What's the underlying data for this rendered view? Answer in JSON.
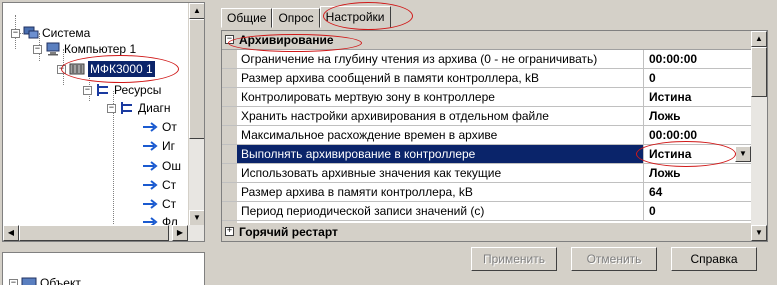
{
  "tree": {
    "items": [
      {
        "label": "Система",
        "expander": "−",
        "icon": "system-icon"
      },
      {
        "label": "Компьютер 1",
        "expander": "−",
        "icon": "computer-icon"
      },
      {
        "label": "МФК3000 1",
        "expander": "−",
        "icon": "controller-icon",
        "selected": true
      },
      {
        "label": "Ресурсы",
        "expander": "−",
        "icon": "resources-icon"
      },
      {
        "label": "Диагн",
        "expander": "−",
        "icon": "diagnostics-icon"
      },
      {
        "label": "От",
        "icon": "arrow-icon"
      },
      {
        "label": "Иг",
        "icon": "arrow-icon"
      },
      {
        "label": "Ош",
        "icon": "arrow-icon"
      },
      {
        "label": "Ст",
        "icon": "arrow-icon"
      },
      {
        "label": "Ст",
        "icon": "arrow-icon"
      },
      {
        "label": "Фл",
        "icon": "arrow-icon"
      }
    ]
  },
  "bottom_tree": {
    "item_label": "Объект"
  },
  "tabs": [
    {
      "label": "Общие",
      "active": false
    },
    {
      "label": "Опрос",
      "active": false
    },
    {
      "label": "Настройки",
      "active": true
    }
  ],
  "grid": {
    "categories": [
      {
        "label": "Архивирование",
        "expander": "−"
      },
      {
        "label": "Горячий рестарт",
        "expander": "+"
      }
    ],
    "rows": [
      {
        "name": "Ограничение на глубину чтения из архива (0 - не ограничивать)",
        "value": "00:00:00"
      },
      {
        "name": "Размер архива сообщений в памяти контроллера, kB",
        "value": "0"
      },
      {
        "name": "Контролировать мертвую зону в контроллере",
        "value": "Истина"
      },
      {
        "name": "Хранить настройки архивирования в отдельном файле",
        "value": "Ложь"
      },
      {
        "name": "Максимальное расхождение времен в архиве",
        "value": "00:00:00"
      },
      {
        "name": "Выполнять архивирование в контроллере",
        "value": "Истина",
        "selected": true
      },
      {
        "name": "Использовать архивные значения как текущие",
        "value": "Ложь"
      },
      {
        "name": "Размер архива в памяти контроллера, kB",
        "value": "64"
      },
      {
        "name": "Период периодической записи значений (с)",
        "value": "0"
      }
    ]
  },
  "buttons": {
    "apply": "Применить",
    "cancel": "Отменить",
    "help": "Справка"
  },
  "colors": {
    "selection": "#0a246a",
    "highlight_oval": "#d01818",
    "face": "#d4d0c8"
  }
}
